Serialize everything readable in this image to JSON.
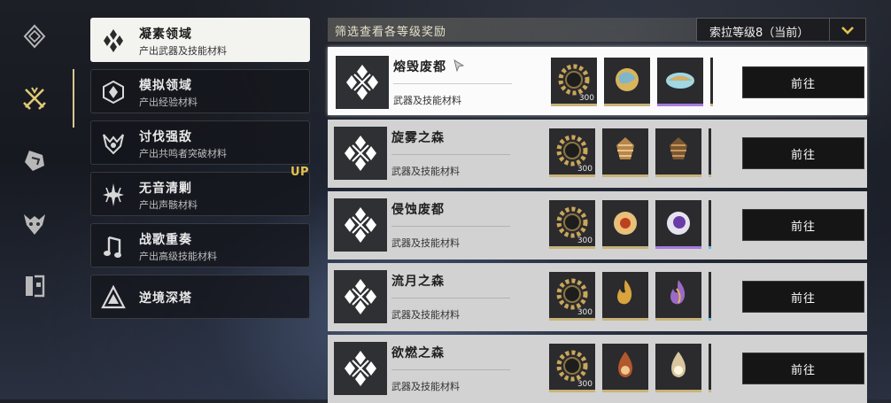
{
  "rail": {
    "items": [
      {
        "icon": "diamond-node-icon"
      },
      {
        "icon": "crossed-swords-icon",
        "active": true
      },
      {
        "icon": "shard-icon"
      },
      {
        "icon": "demon-mask-icon"
      },
      {
        "icon": "tower-door-icon"
      }
    ]
  },
  "categories": [
    {
      "title": "凝素领域",
      "subtitle": "产出武器及技能材料",
      "icon": "crystal-cluster-icon",
      "active": true
    },
    {
      "title": "模拟领域",
      "subtitle": "产出经验材料",
      "icon": "hex-emblem-icon"
    },
    {
      "title": "讨伐强敌",
      "subtitle": "产出共鸣者突破材料",
      "icon": "horned-crest-icon"
    },
    {
      "title": "无音清剿",
      "subtitle": "产出声骸材料",
      "icon": "starburst-icon"
    },
    {
      "title": "战歌重奏",
      "subtitle": "产出高级技能材料",
      "icon": "music-note-icon"
    },
    {
      "title": "逆境深塔",
      "subtitle": "",
      "icon": "triangle-tower-icon"
    }
  ],
  "up_badge": "UP",
  "filter": {
    "title": "筛选查看各等级奖励",
    "level_selected": "索拉等级8（当前）"
  },
  "rows": [
    {
      "name": "熔毁废都",
      "desc": "武器及技能材料",
      "button": "前往",
      "active": true,
      "items": [
        {
          "kind": "gear",
          "count": "300"
        },
        {
          "kind": "orb-gold"
        },
        {
          "kind": "shell-purple",
          "tier": "purple"
        },
        {
          "kind": "partial"
        }
      ]
    },
    {
      "name": "旋雾之森",
      "desc": "武器及技能材料",
      "button": "前往",
      "items": [
        {
          "kind": "gear",
          "count": "300"
        },
        {
          "kind": "spiral-bronze"
        },
        {
          "kind": "spiral-dark"
        },
        {
          "kind": "partial"
        }
      ]
    },
    {
      "name": "侵蚀废都",
      "desc": "武器及技能材料",
      "button": "前往",
      "items": [
        {
          "kind": "gear",
          "count": "300"
        },
        {
          "kind": "orb-fire"
        },
        {
          "kind": "orb-violet",
          "tier": "purple"
        },
        {
          "kind": "partial",
          "tier": "blue"
        }
      ]
    },
    {
      "name": "流月之森",
      "desc": "武器及技能材料",
      "button": "前往",
      "items": [
        {
          "kind": "gear",
          "count": "300"
        },
        {
          "kind": "flame-gold"
        },
        {
          "kind": "flame-violet"
        },
        {
          "kind": "partial",
          "tier": "blue"
        }
      ]
    },
    {
      "name": "欲燃之森",
      "desc": "武器及技能材料",
      "button": "前往",
      "items": [
        {
          "kind": "gear",
          "count": "300"
        },
        {
          "kind": "drop-ember"
        },
        {
          "kind": "drop-pale"
        },
        {
          "kind": "partial"
        }
      ]
    }
  ]
}
